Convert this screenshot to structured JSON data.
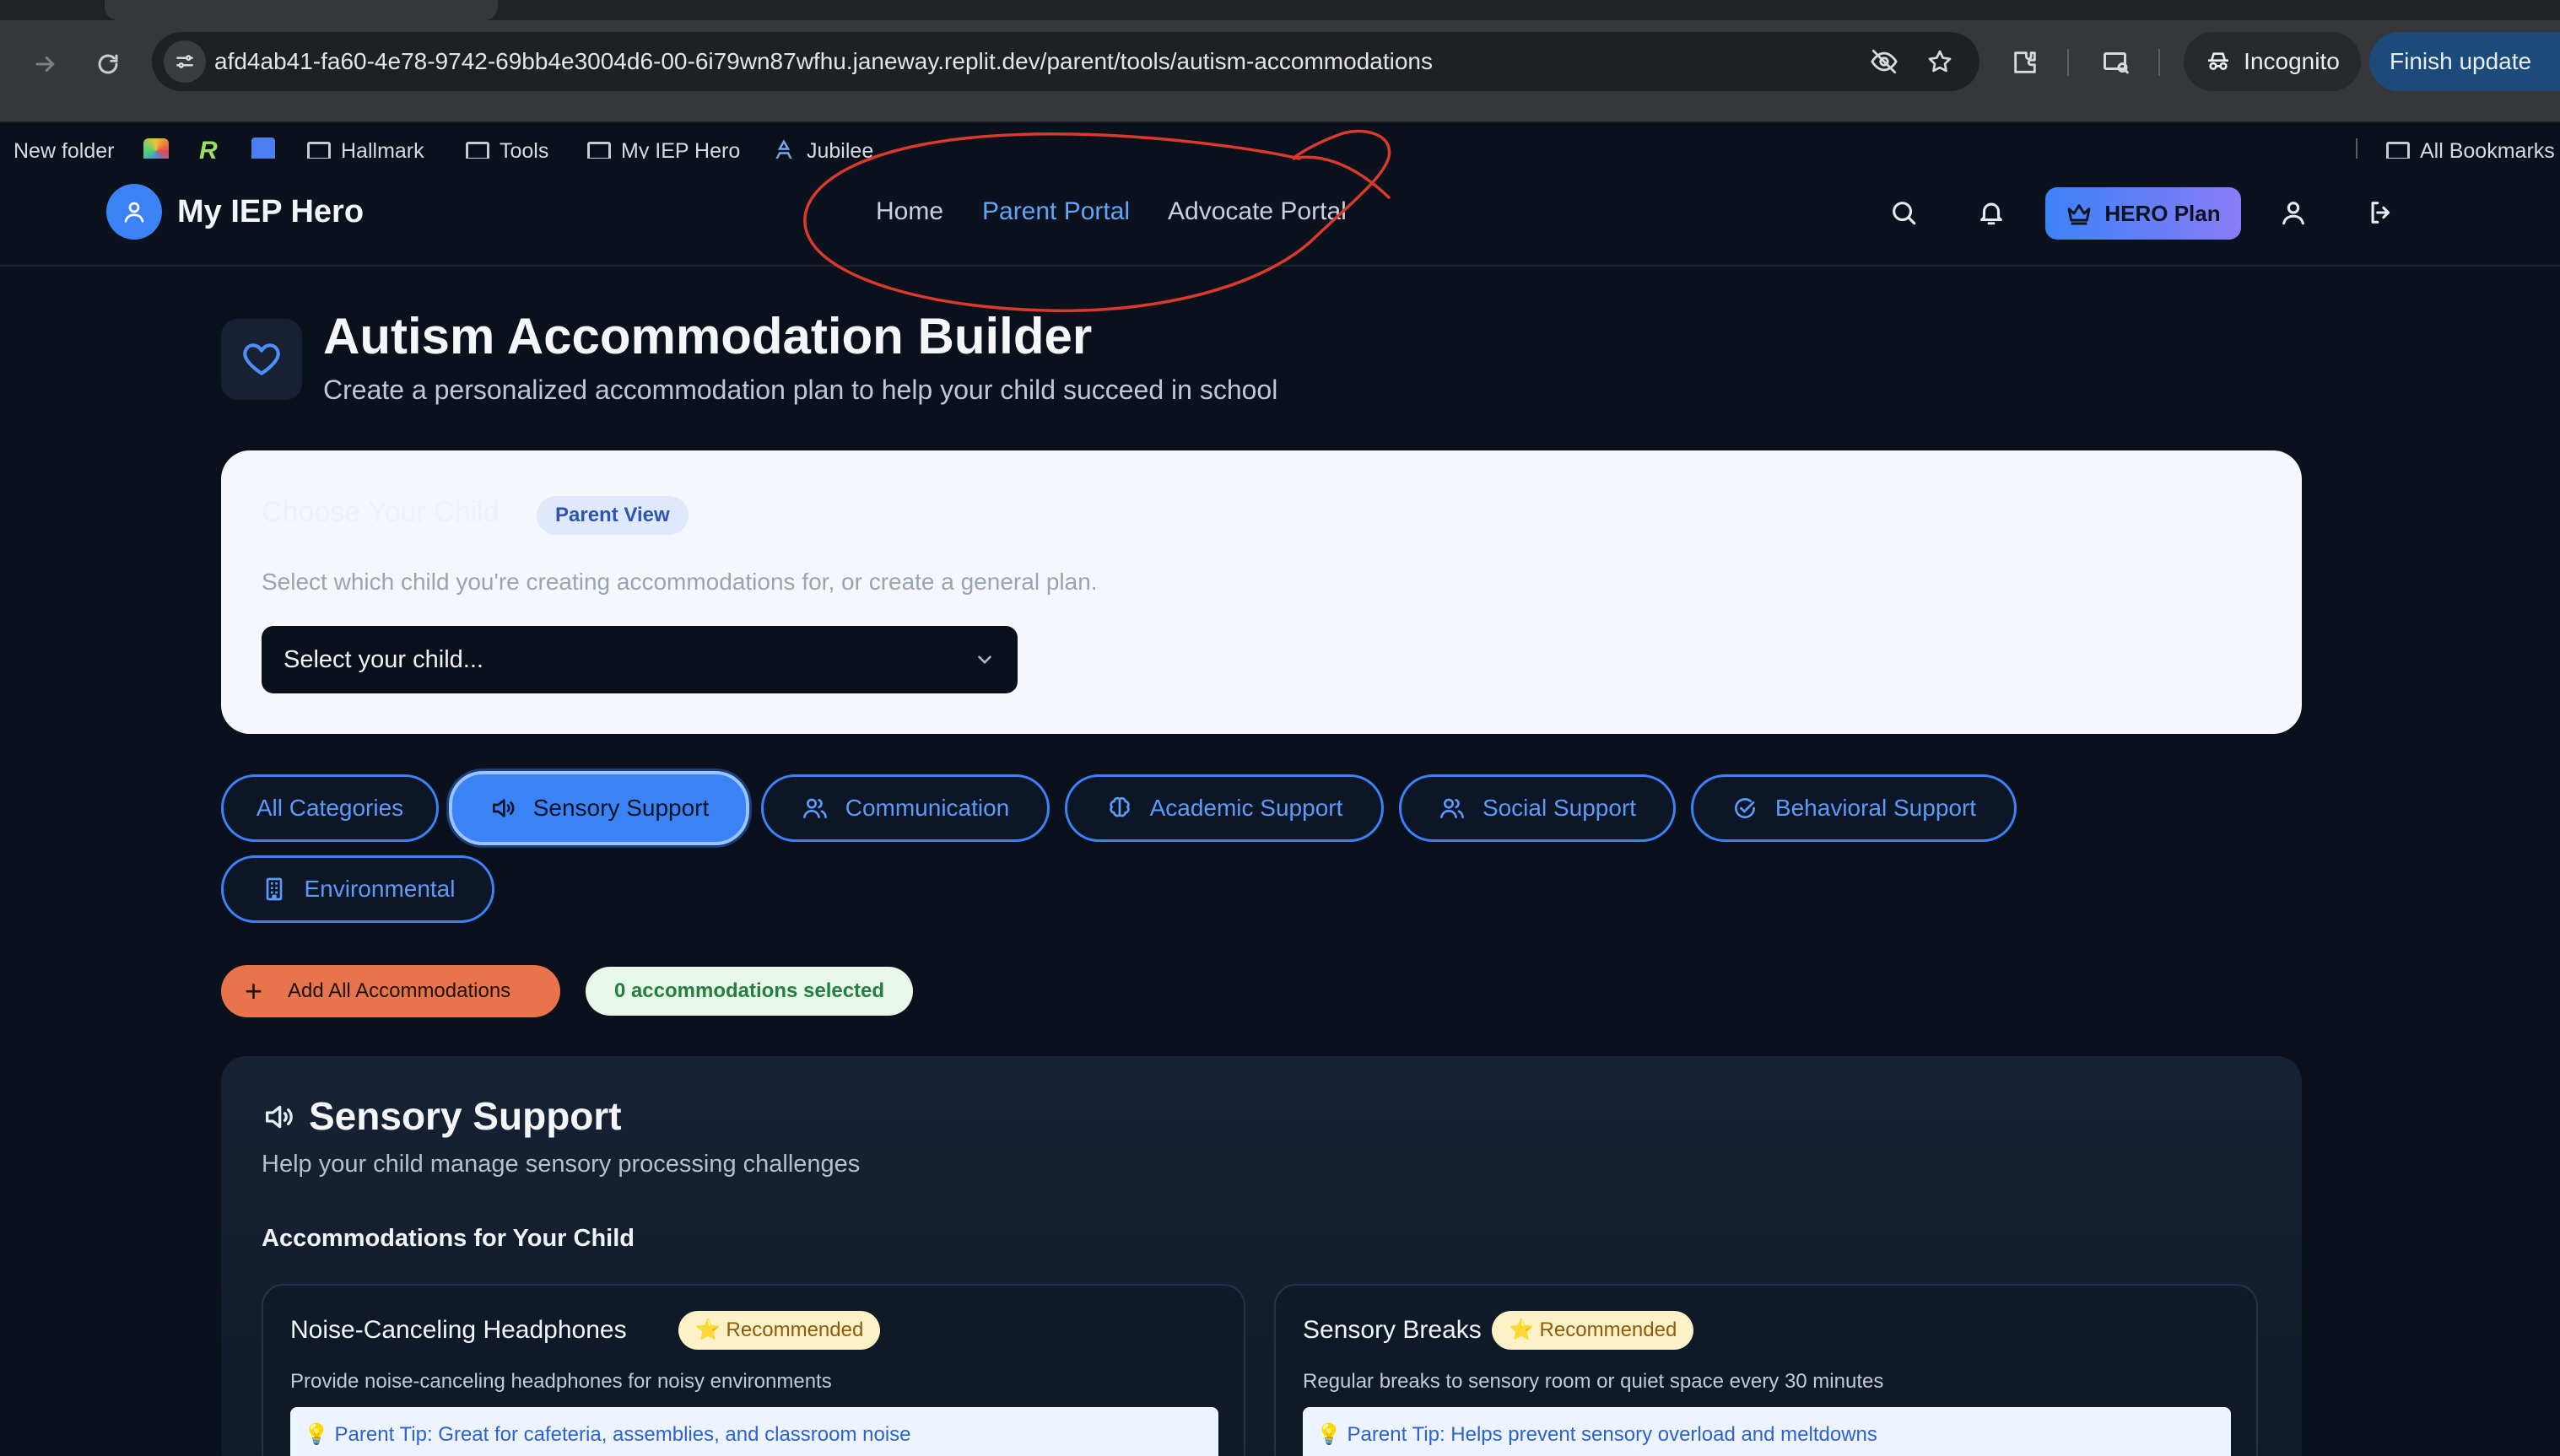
{
  "browser": {
    "url": "afd4ab41-fa60-4e78-9742-69bb4e3004d6-00-6i79wn87wfhu.janeway.replit.dev/parent/tools/autism-accommodations",
    "incognito_label": "Incognito",
    "finish_update_label": "Finish update",
    "bookmarks": [
      {
        "label": "New folder",
        "icon": "folder-icon"
      },
      {
        "label": "",
        "icon": "rainbow-favicon"
      },
      {
        "label": "",
        "icon": "r-favicon"
      },
      {
        "label": "",
        "icon": "docs-favicon"
      },
      {
        "label": "Hallmark",
        "icon": "folder-icon"
      },
      {
        "label": "Tools",
        "icon": "folder-icon"
      },
      {
        "label": "My IEP Hero",
        "icon": "folder-icon"
      },
      {
        "label": "Jubilee",
        "icon": "jubilee-favicon"
      }
    ],
    "all_bookmarks_label": "All Bookmarks"
  },
  "header": {
    "brand": "My IEP Hero",
    "nav": [
      {
        "label": "Home",
        "active": false
      },
      {
        "label": "Parent Portal",
        "active": true
      },
      {
        "label": "Advocate Portal",
        "active": false
      }
    ],
    "plan_label": "HERO Plan",
    "annotation_color": "#d93a2b"
  },
  "page": {
    "title": "Autism Accommodation Builder",
    "subtitle": "Create a personalized accommodation plan to help your child succeed in school"
  },
  "child_card": {
    "title": "Choose Your Child",
    "badge": "Parent View",
    "description": "Select which child you're creating accommodations for, or create a general plan.",
    "select_placeholder": "Select your child..."
  },
  "categories": [
    {
      "label": "All Categories",
      "icon": "",
      "active": false
    },
    {
      "label": "Sensory Support",
      "icon": "volume-icon",
      "active": true
    },
    {
      "label": "Communication",
      "icon": "users-icon",
      "active": false
    },
    {
      "label": "Academic Support",
      "icon": "brain-icon",
      "active": false
    },
    {
      "label": "Social Support",
      "icon": "users-icon",
      "active": false
    },
    {
      "label": "Behavioral Support",
      "icon": "check-circle-icon",
      "active": false
    },
    {
      "label": "Environmental",
      "icon": "building-icon",
      "active": false
    }
  ],
  "actions": {
    "add_all_label": "Add All Accommodations",
    "selected_count": "0 accommodations selected"
  },
  "section": {
    "title": "Sensory Support",
    "description": "Help your child manage sensory processing challenges",
    "subheading": "Accommodations for Your Child",
    "accommodations": [
      {
        "name": "Noise-Canceling Headphones",
        "badge": "⭐ Recommended",
        "description": "Provide noise-canceling headphones for noisy environments",
        "tip": "💡 Parent Tip: Great for cafeteria, assemblies, and classroom noise"
      },
      {
        "name": "Sensory Breaks",
        "badge": "⭐ Recommended",
        "description": "Regular breaks to sensory room or quiet space every 30 minutes",
        "tip": "💡 Parent Tip: Helps prevent sensory overload and meltdowns"
      }
    ]
  },
  "colors": {
    "accent": "#3b82f6",
    "active_nav": "#60a5fa",
    "add_button": "#e8744c",
    "page_bg": "#0b111c"
  }
}
